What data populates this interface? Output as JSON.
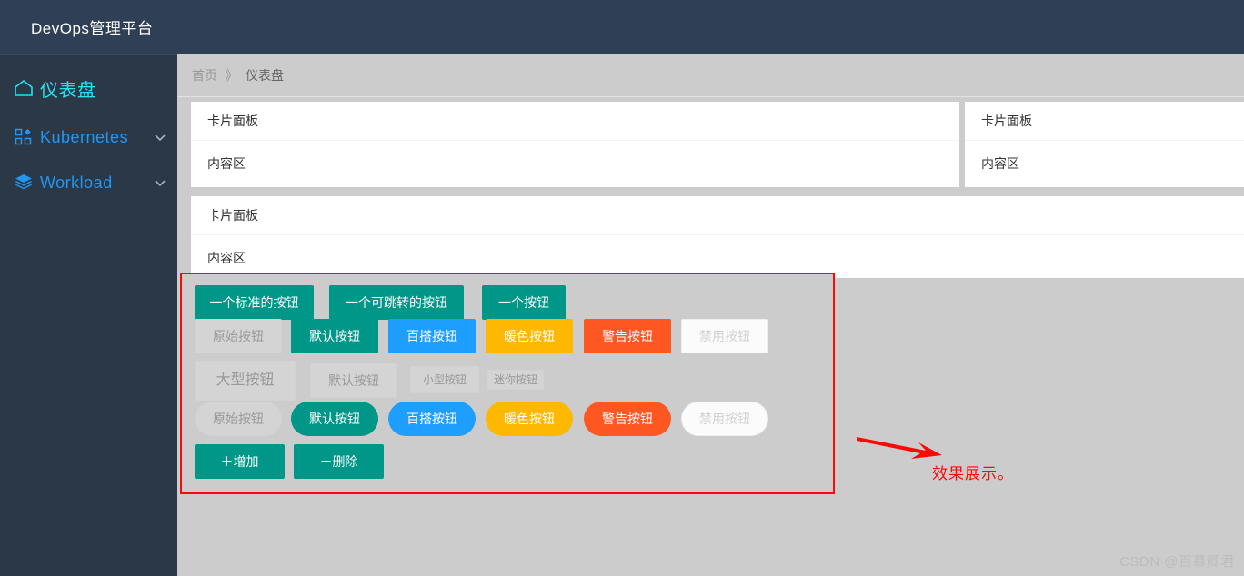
{
  "header": {
    "brand": "DevOps管理平台"
  },
  "sidebar": {
    "items": [
      {
        "label": "仪表盘",
        "icon": "home-icon",
        "active": true,
        "has_chevron": false
      },
      {
        "label": "Kubernetes",
        "icon": "grid-icon",
        "active": false,
        "has_chevron": true
      },
      {
        "label": "Workload",
        "icon": "layers-icon",
        "active": false,
        "has_chevron": true
      }
    ]
  },
  "breadcrumb": {
    "home": "首页",
    "separator": "》",
    "current": "仪表盘"
  },
  "cards": [
    {
      "title": "卡片面板",
      "body": "内容区"
    },
    {
      "title": "卡片面板",
      "body": "内容区"
    },
    {
      "title": "卡片面板",
      "body": "内容区"
    }
  ],
  "buttons": {
    "row1": [
      {
        "label": "一个标准的按钮",
        "style": "primary"
      },
      {
        "label": "一个可跳转的按钮",
        "style": "primary"
      },
      {
        "label": "一个按钮",
        "style": "primary"
      }
    ],
    "row2": [
      {
        "label": "原始按钮",
        "style": "primary-outline"
      },
      {
        "label": "默认按钮",
        "style": "primary"
      },
      {
        "label": "百搭按钮",
        "style": "normal"
      },
      {
        "label": "暖色按钮",
        "style": "warm"
      },
      {
        "label": "警告按钮",
        "style": "danger"
      },
      {
        "label": "禁用按钮",
        "style": "disabled"
      }
    ],
    "row3": [
      {
        "label": "大型按钮",
        "style": "ghost",
        "size": "lg"
      },
      {
        "label": "默认按钮",
        "style": "ghost",
        "size": "md"
      },
      {
        "label": "小型按钮",
        "style": "ghost",
        "size": "sm"
      },
      {
        "label": "迷你按钮",
        "style": "ghost",
        "size": "xs"
      }
    ],
    "row4": [
      {
        "label": "原始按钮",
        "style": "ghost-radius"
      },
      {
        "label": "默认按钮",
        "style": "primary"
      },
      {
        "label": "百搭按钮",
        "style": "normal"
      },
      {
        "label": "暖色按钮",
        "style": "warm"
      },
      {
        "label": "警告按钮",
        "style": "danger"
      },
      {
        "label": "禁用按钮",
        "style": "disabled"
      }
    ],
    "row5": [
      {
        "label": "＋增加",
        "style": "primary"
      },
      {
        "label": "－删除",
        "style": "primary"
      }
    ]
  },
  "annotation": {
    "text": "效果展示。",
    "color": "#fa0a07"
  },
  "watermark": "CSDN @百慕卿君",
  "colors": {
    "topbar": "#2f4056",
    "sidebar": "#2b3848",
    "page_bg": "#cccccc",
    "accent_cyan": "#25e3f0",
    "nav_blue": "#2196f3",
    "btn_primary": "#009688",
    "btn_normal": "#1e9fff",
    "btn_warm": "#ffb800",
    "btn_danger": "#ff5722",
    "annotation_red": "#fa0a07"
  }
}
